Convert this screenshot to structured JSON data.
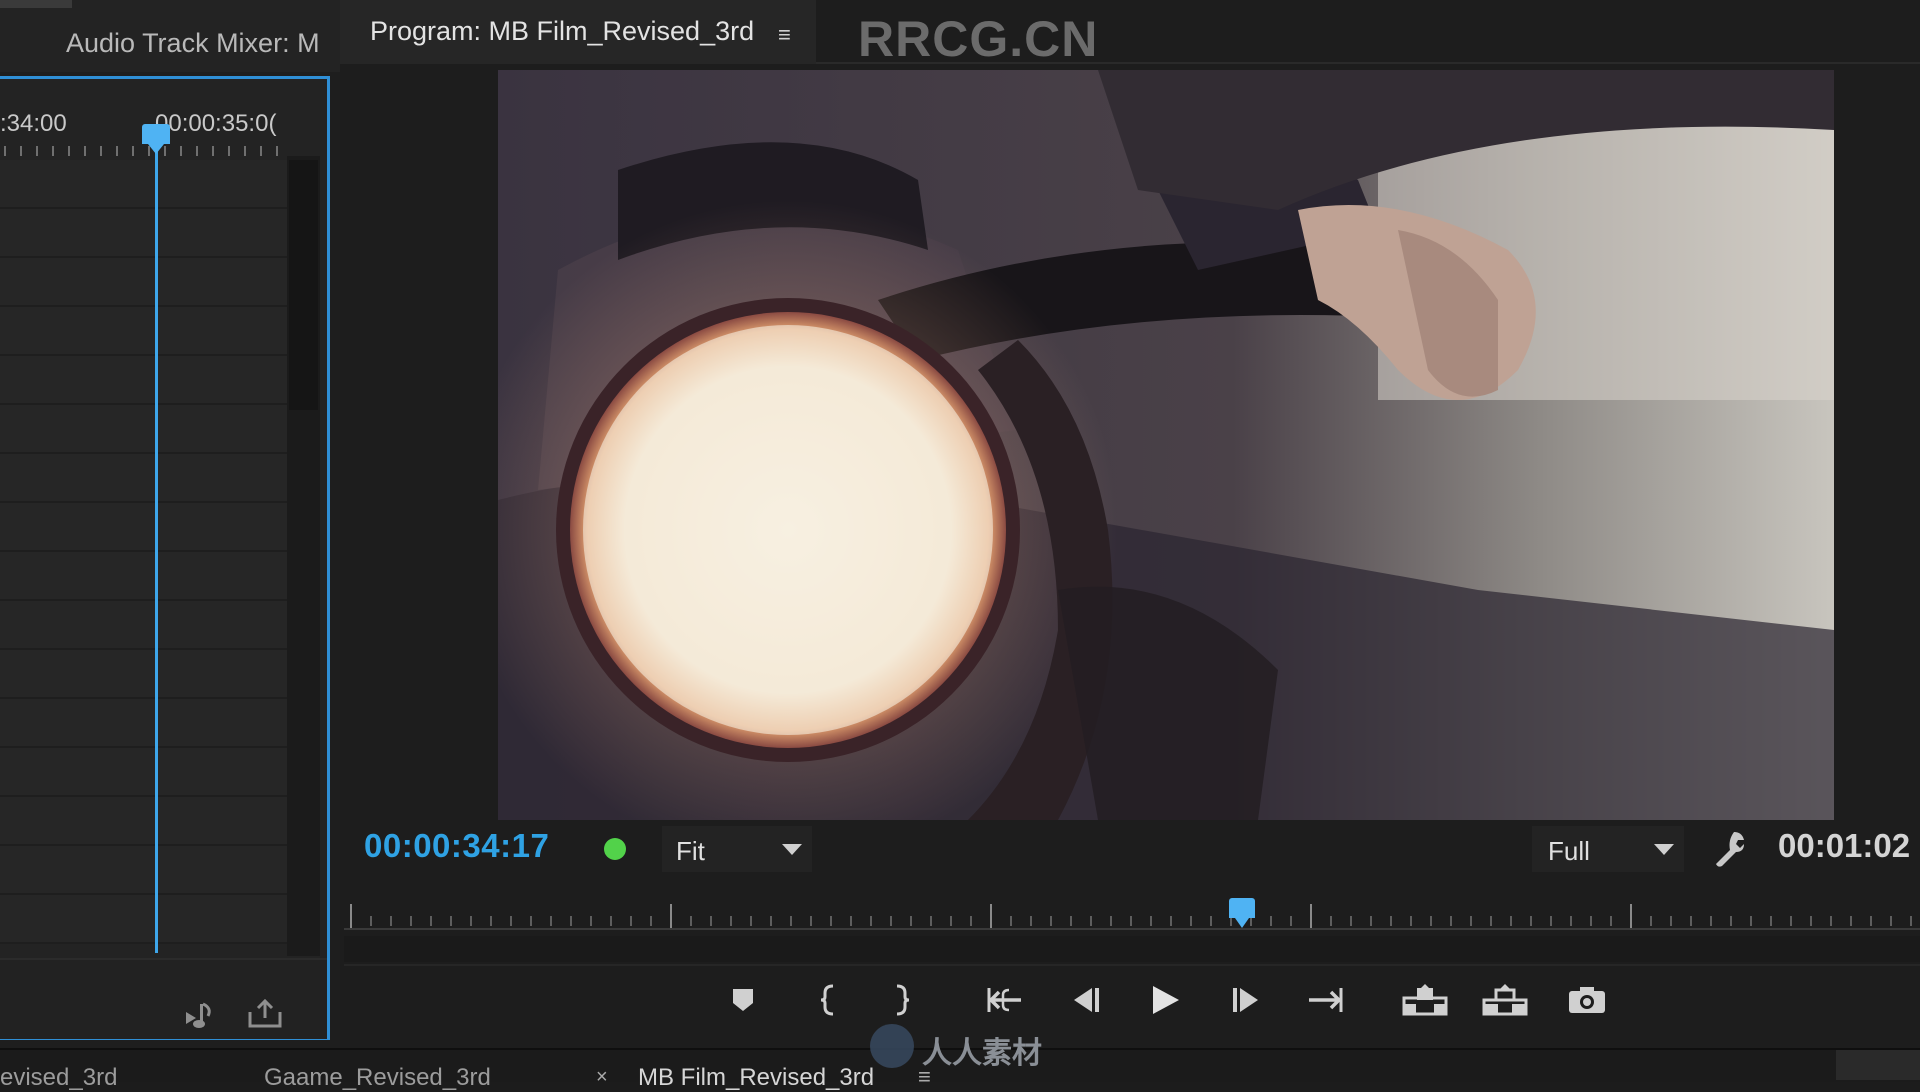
{
  "left_panel": {
    "tab_label": "Audio Track Mixer: M",
    "ruler": {
      "label_1": ":34:00",
      "label_2": "00:00:35:0("
    }
  },
  "program": {
    "tab_label": "Program: MB Film_Revised_3rd",
    "tab_menu_glyph": "≡",
    "watermark": "RRCG.CN",
    "timecode_current": "00:00:34:17",
    "zoom": "Fit",
    "resolution": "Full",
    "timecode_duration": "00:01:02",
    "playhead_position_fraction": 0.47,
    "status_color": "#52d24a",
    "accent_color": "#2fa2e4"
  },
  "controls": [
    {
      "icon": "add-marker-icon"
    },
    {
      "icon": "mark-in-icon"
    },
    {
      "icon": "mark-out-icon"
    },
    {
      "icon": "go-to-in-icon"
    },
    {
      "icon": "step-back-icon"
    },
    {
      "icon": "play-icon"
    },
    {
      "icon": "step-forward-icon"
    },
    {
      "icon": "go-to-out-icon"
    },
    {
      "icon": "lift-icon"
    },
    {
      "icon": "extract-icon"
    },
    {
      "icon": "export-frame-icon"
    }
  ],
  "bottom_tabs": {
    "tab_1": "evised_3rd",
    "tab_2": "Gaame_Revised_3rd",
    "tab_close": "×",
    "tab_3": "MB Film_Revised_3rd",
    "tab_3_menu": "≡"
  },
  "bottom_logo_text": "人人素材"
}
